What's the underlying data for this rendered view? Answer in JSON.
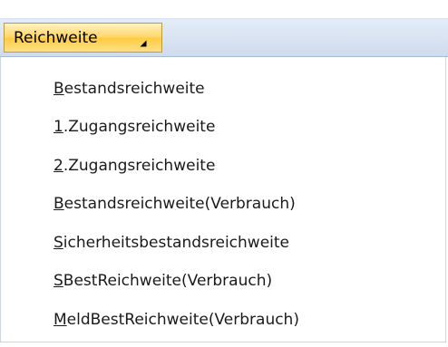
{
  "menu_button": {
    "label": "Reichweite",
    "arrow_icon": "dropdown-corner-arrow-icon"
  },
  "menu": {
    "items": [
      {
        "mnemonic": "B",
        "rest": "estandsreichweite",
        "label": "Bestandsreichweite"
      },
      {
        "mnemonic": "1",
        "rest": ".Zugangsreichweite",
        "label": "1.Zugangsreichweite"
      },
      {
        "mnemonic": "2",
        "rest": ".Zugangsreichweite",
        "label": "2.Zugangsreichweite"
      },
      {
        "mnemonic": "B",
        "rest": "estandsreichweite(Verbrauch)",
        "label": "Bestandsreichweite(Verbrauch)"
      },
      {
        "mnemonic": "S",
        "rest": "icherheitsbestandsreichweite",
        "label": "Sicherheitsbestandsreichweite"
      },
      {
        "mnemonic": "S",
        "rest": "BestReichweite(Verbrauch)",
        "label": "SBestReichweite(Verbrauch)"
      },
      {
        "mnemonic": "M",
        "rest": "eldBestReichweite(Verbrauch)",
        "label": "MeldBestReichweite(Verbrauch)"
      }
    ]
  },
  "colors": {
    "button_highlight": "#ffd565",
    "menubar": "#d6e1f0",
    "text": "#1a1a1a"
  }
}
